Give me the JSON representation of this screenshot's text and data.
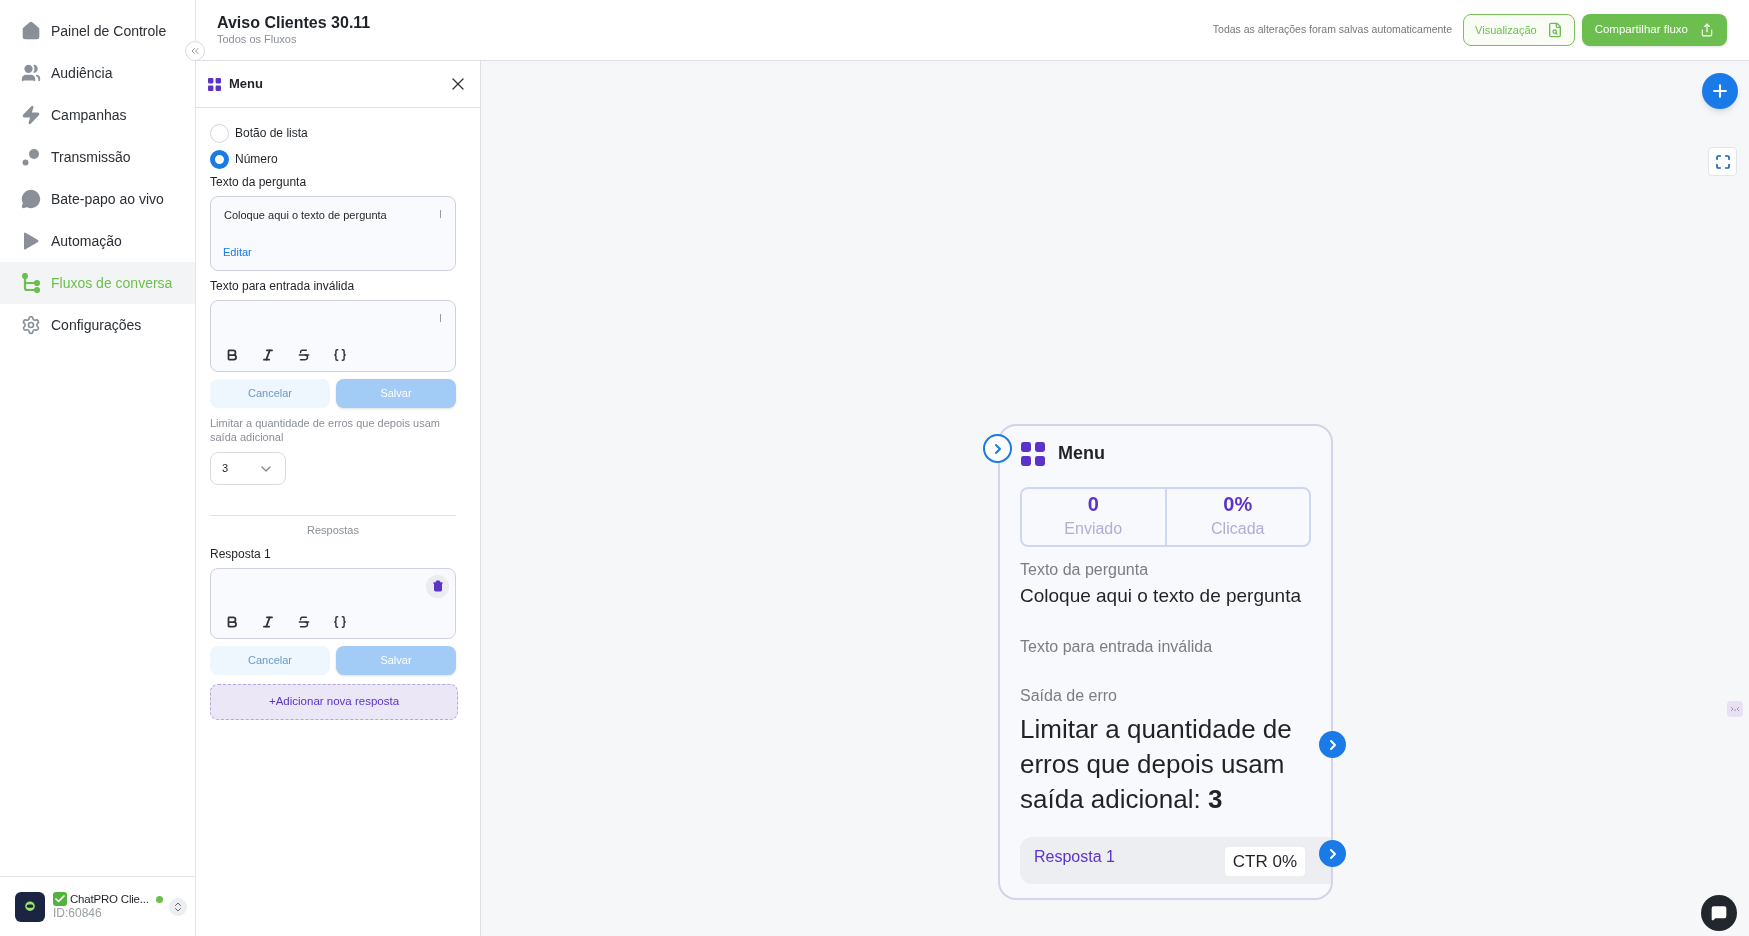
{
  "sidebar": {
    "items": [
      {
        "label": "Painel de Controle",
        "selected": false
      },
      {
        "label": "Audiência",
        "selected": false
      },
      {
        "label": "Campanhas",
        "selected": false
      },
      {
        "label": "Transmissão",
        "selected": false
      },
      {
        "label": "Bate-papo ao vivo",
        "selected": false
      },
      {
        "label": "Automação",
        "selected": false
      },
      {
        "label": "Fluxos de conversa",
        "selected": true
      },
      {
        "label": "Configurações",
        "selected": false
      }
    ],
    "account": {
      "name": "ChatPRO Clie...",
      "id": "ID:60846",
      "online": true
    }
  },
  "header": {
    "title": "Aviso Clientes 30.11",
    "breadcrumb": "Todos os Fluxos",
    "save_status": "Todas as alterações foram salvas automaticamente",
    "preview_button": "Visualização",
    "share_button": "Compartilhar fluxo"
  },
  "panel": {
    "title": "Menu",
    "options": [
      {
        "label": "Botão de lista",
        "selected": false
      },
      {
        "label": "Número",
        "selected": true
      }
    ],
    "question_label": "Texto da pergunta",
    "question_text": "Coloque aqui o texto de pergunta",
    "edit_link": "Editar",
    "invalid_label": "Texto para entrada inválida",
    "invalid_buttons": {
      "cancel": "Cancelar",
      "save": "Salvar",
      "disabled": true
    },
    "limit_label": "Limitar a quantidade de erros que depois usam saída adicional",
    "limit_value": "3",
    "answers_heading": "Respostas",
    "answers": [
      {
        "label": "Resposta 1",
        "buttons": {
          "cancel": "Cancelar",
          "save": "Salvar",
          "disabled": true
        }
      }
    ],
    "add_answer": "+Adicionar nova resposta"
  },
  "node": {
    "title": "Menu",
    "stats": [
      {
        "value": "0",
        "label": "Enviado"
      },
      {
        "value": "0%",
        "label": "Clicada"
      }
    ],
    "question_label": "Texto da pergunta",
    "question_text": "Coloque aqui o texto de pergunta",
    "invalid_label": "Texto para entrada inválida",
    "error_label": "Saída de erro",
    "error_text": "Limitar a quantidade de erros que depois usam saída adicional: **3**",
    "answers": [
      {
        "label": "Resposta 1",
        "ctr": "CTR 0%"
      }
    ]
  }
}
